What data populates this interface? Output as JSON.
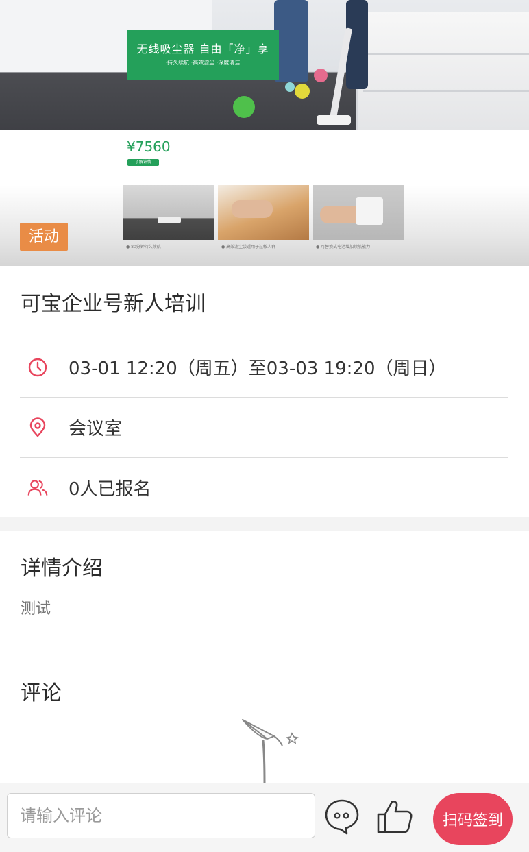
{
  "banner": {
    "promo_title": "无线吸尘器 自由「净」享",
    "promo_subtitle": "·持久续航 ·高效滤尘 ·深度清洁",
    "price": "¥7560",
    "price_badge": "了解详情",
    "tag": "活动",
    "captions": [
      "● 80分钟持久续航",
      "● 高效滤尘袋适用于过敏人群",
      "● 可替换式电池增加续航能力"
    ]
  },
  "event": {
    "title": "可宝企业号新人培训",
    "time": "03-01 12:20（周五）至03-03 19:20（周日）",
    "location": "会议室",
    "signups": "0人已报名"
  },
  "details": {
    "heading": "详情介绍",
    "content": "测试"
  },
  "comments": {
    "heading": "评论"
  },
  "bottom_bar": {
    "comment_placeholder": "请输入评论",
    "checkin_label": "扫码签到"
  },
  "colors": {
    "accent_pink": "#e8455d",
    "tag_orange": "#e98c46",
    "promo_green": "#24a05a"
  },
  "icons": {
    "time": "clock-icon",
    "location": "location-pin-icon",
    "signups": "users-icon",
    "chat": "chat-bubble-icon",
    "like": "thumbs-up-icon"
  }
}
